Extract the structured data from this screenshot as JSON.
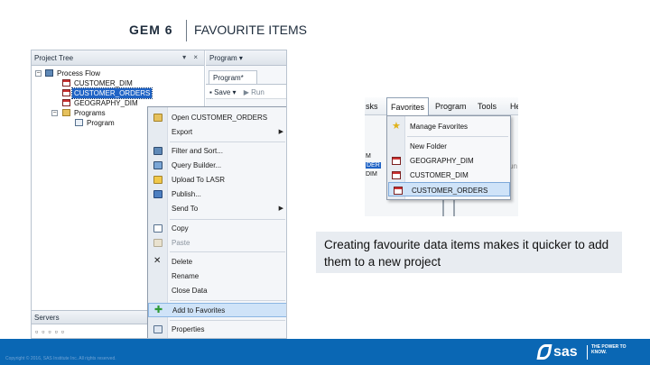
{
  "header": {
    "gem": "GEM 6",
    "title": "FAVOURITE ITEMS"
  },
  "left_screenshot": {
    "project_tree": {
      "title": "Project Tree",
      "controls": "▾ ×",
      "items": [
        {
          "label": "Process Flow",
          "icon": "process-flow-icon"
        },
        {
          "label": "CUSTOMER_DIM",
          "icon": "table-icon"
        },
        {
          "label": "CUSTOMER_ORDERS",
          "icon": "table-icon",
          "selected": true
        },
        {
          "label": "GEOGRAPHY_DIM",
          "icon": "table-icon"
        },
        {
          "label": "Programs",
          "icon": "folder-icon"
        },
        {
          "label": "Program",
          "icon": "program-icon"
        }
      ]
    },
    "servers": {
      "title": "Servers"
    },
    "program_pane": {
      "title": "Program",
      "tab": "Program*",
      "save_label": "Save",
      "run_label": "Run"
    },
    "context_menu": {
      "items": [
        {
          "label": "Open CUSTOMER_ORDERS",
          "icon": "open-folder-icon",
          "submenu": false
        },
        {
          "label": "Export",
          "icon": "",
          "submenu": true
        },
        {
          "label": "Filter and Sort...",
          "icon": "filter-icon",
          "submenu": false
        },
        {
          "label": "Query Builder...",
          "icon": "query-builder-icon",
          "submenu": false
        },
        {
          "label": "Upload To LASR",
          "icon": "upload-icon",
          "submenu": false
        },
        {
          "label": "Publish...",
          "icon": "publish-icon",
          "submenu": false
        },
        {
          "label": "Send To",
          "icon": "",
          "submenu": true
        },
        {
          "label": "Copy",
          "icon": "copy-icon",
          "submenu": false
        },
        {
          "label": "Paste",
          "icon": "paste-icon",
          "submenu": false,
          "disabled": true
        },
        {
          "label": "Delete",
          "icon": "delete-icon",
          "submenu": false
        },
        {
          "label": "Rename",
          "icon": "",
          "submenu": false
        },
        {
          "label": "Close Data",
          "icon": "",
          "submenu": false
        },
        {
          "label": "Add to Favorites",
          "icon": "add-favorite-icon",
          "submenu": false,
          "highlighted": true
        },
        {
          "label": "Properties",
          "icon": "properties-icon",
          "submenu": false
        }
      ]
    }
  },
  "right_screenshot": {
    "menubar": [
      "sks",
      "Favorites",
      "Program",
      "Tools",
      "He"
    ],
    "favorites_menu": [
      {
        "label": "Manage Favorites",
        "icon": "star-icon"
      },
      {
        "label": "New Folder",
        "icon": ""
      },
      {
        "label": "GEOGRAPHY_DIM",
        "icon": "table-icon"
      },
      {
        "label": "CUSTOMER_DIM",
        "icon": "table-icon"
      },
      {
        "label": "CUSTOMER_ORDERS",
        "icon": "table-icon",
        "highlighted": true
      }
    ],
    "background_fragments": [
      "M",
      "DER",
      "DIM",
      "un"
    ]
  },
  "caption": "Creating favourite data items makes it quicker to add them to a new project",
  "footer": {
    "copyright": "Copyright © 2016, SAS Institute Inc. All rights reserved.",
    "brand": "sas",
    "tagline": "THE POWER TO KNOW."
  },
  "colors": {
    "footer_blue": "#0a67b4",
    "selection_blue": "#1f63c5",
    "highlight": "#cfe3f8",
    "caption_bg": "#e8ecf1"
  }
}
